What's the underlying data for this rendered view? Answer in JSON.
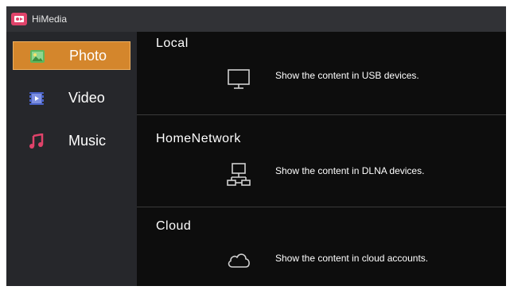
{
  "titlebar": {
    "app_name": "HiMedia",
    "logo_icon": "himedia-logo-icon",
    "logo_color": "#e0436a"
  },
  "sidebar": {
    "items": [
      {
        "label": "Photo",
        "icon": "photo-icon",
        "active": true
      },
      {
        "label": "Video",
        "icon": "video-icon",
        "active": false
      },
      {
        "label": "Music",
        "icon": "music-icon",
        "active": false
      }
    ],
    "active_color": "#d4862c"
  },
  "sections": [
    {
      "title": "Local",
      "icon": "monitor-icon",
      "description": "Show the content in USB devices."
    },
    {
      "title": "HomeNetwork",
      "icon": "network-icon",
      "description": "Show the content in DLNA devices."
    },
    {
      "title": "Cloud",
      "icon": "cloud-icon",
      "description": "Show the content in cloud accounts."
    }
  ]
}
